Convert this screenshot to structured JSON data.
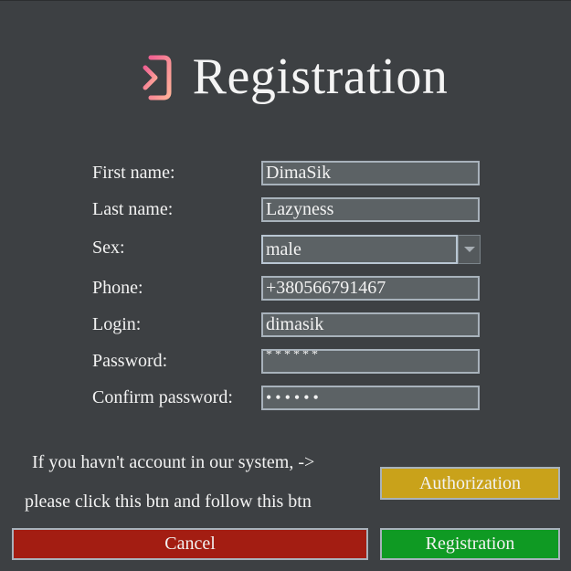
{
  "header": {
    "title": "Registration",
    "icon": "login-arrow-icon",
    "icon_colors": [
      "#f06292",
      "#ffb199"
    ]
  },
  "form": {
    "first_name": {
      "label": "First name:",
      "value": "DimaSik"
    },
    "last_name": {
      "label": "Last name:",
      "value": "Lazyness"
    },
    "sex": {
      "label": "Sex:",
      "value": "male",
      "icon": "chevron-down-icon"
    },
    "phone": {
      "label": "Phone:",
      "value": "+380566791467"
    },
    "login": {
      "label": "Login:",
      "value": "dimasik"
    },
    "password": {
      "label": "Password:",
      "value": "******"
    },
    "confirm_password": {
      "label": "Confirm password:",
      "value": "••••••"
    }
  },
  "info": {
    "line1": "If you havn't account in our system, ->",
    "line2": "please click this btn and follow this btn"
  },
  "buttons": {
    "authorization": "Authorization",
    "cancel": "Cancel",
    "registration": "Registration"
  },
  "colors": {
    "background": "#3d4043",
    "field_bg": "#5c6265",
    "authorization": "#c9a21a",
    "cancel": "#a31d12",
    "registration": "#0f9a23"
  }
}
